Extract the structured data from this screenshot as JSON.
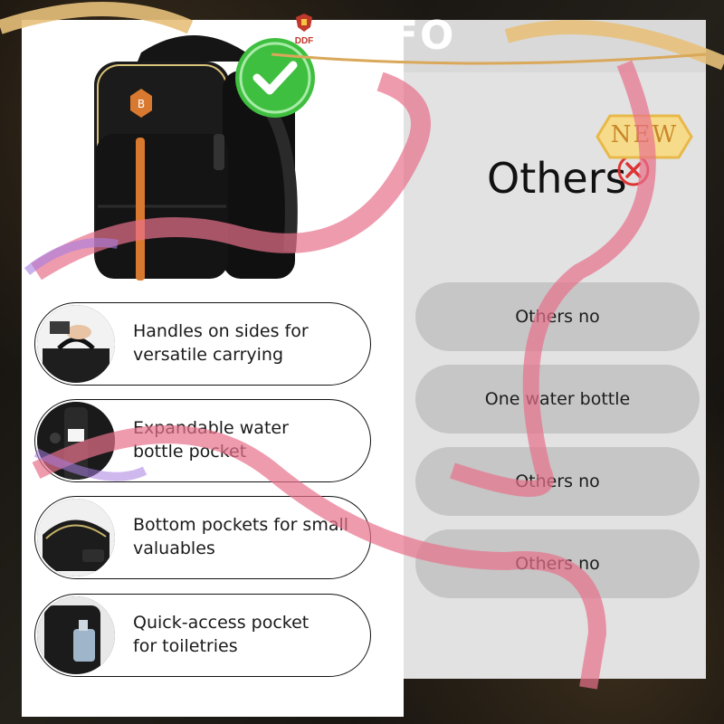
{
  "header": {
    "corner_text": "FO",
    "brand": "DDF"
  },
  "features": [
    {
      "text": [
        "Handles on sides for",
        "versatile carrying"
      ],
      "thumb_icon": "hand-holding-handle-icon"
    },
    {
      "text": [
        "Expandable water",
        "bottle pocket"
      ],
      "thumb_icon": "bottle-pocket-icon"
    },
    {
      "text": [
        "Bottom pockets for small",
        "valuables"
      ],
      "thumb_icon": "bottom-pocket-icon"
    },
    {
      "text": [
        "Quick-access pocket",
        "for toiletries"
      ],
      "thumb_icon": "toiletry-pocket-icon"
    }
  ],
  "options_panel": {
    "title": "Others",
    "badge": "NEW",
    "options": [
      "Others no",
      "One water bottle",
      "Others no",
      "Others no"
    ]
  },
  "colors": {
    "panel_bg": "#e2e2e2",
    "option_bg": "#c6c6c6",
    "check_green": "#3fbf3f",
    "ribbon_pink": "#e8708c",
    "badge_gold": "#e8b84a",
    "backpack_accent": "#d9792f"
  }
}
